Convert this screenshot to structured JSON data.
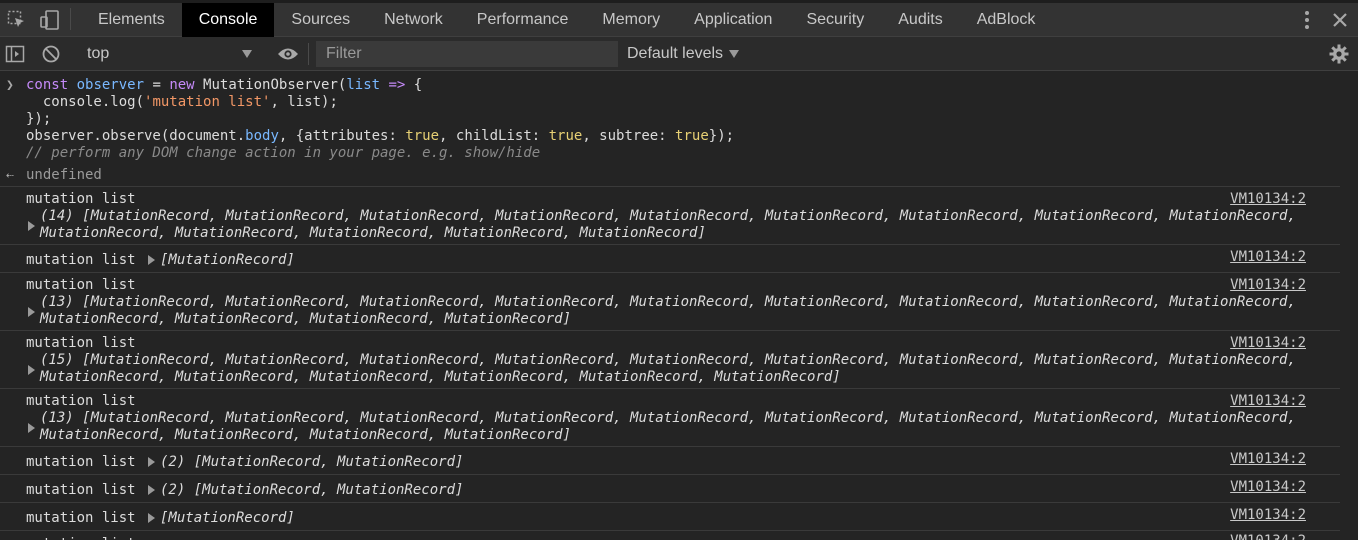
{
  "tabs": [
    {
      "label": "Elements",
      "active": false
    },
    {
      "label": "Console",
      "active": true
    },
    {
      "label": "Sources",
      "active": false
    },
    {
      "label": "Network",
      "active": false
    },
    {
      "label": "Performance",
      "active": false
    },
    {
      "label": "Memory",
      "active": false
    },
    {
      "label": "Application",
      "active": false
    },
    {
      "label": "Security",
      "active": false
    },
    {
      "label": "Audits",
      "active": false
    },
    {
      "label": "AdBlock",
      "active": false
    }
  ],
  "toolbar": {
    "context": "top",
    "filter_placeholder": "Filter",
    "levels": "Default levels"
  },
  "input": {
    "line1": {
      "kw1": "const",
      "var1": "observer",
      "eq": " = ",
      "kw2": "new",
      "rest1": " MutationObserver(",
      "var2": "list",
      "arrow": " => ",
      "brace": "{"
    },
    "line2": {
      "pre": "  console.log(",
      "str": "'mutation list'",
      "post": ", list);"
    },
    "line3": "});",
    "line4": {
      "a": "observer.observe(document.",
      "b": "body",
      "c": ", {attributes: ",
      "t1": "true",
      "d": ", childList: ",
      "t2": "true",
      "e": ", subtree: ",
      "t3": "true",
      "f": "});"
    },
    "line5": "// perform any DOM change action in your page. e.g. show/hide"
  },
  "result": "undefined",
  "log_label": "mutation list",
  "source": "VM10134:2",
  "logs": [
    {
      "line1": "(14) [MutationRecord, MutationRecord, MutationRecord, MutationRecord, MutationRecord, MutationRecord, MutationRecord, MutationRecord, MutationRecord,",
      "line2": "MutationRecord, MutationRecord, MutationRecord, MutationRecord, MutationRecord]"
    },
    {
      "inline": "[MutationRecord]"
    },
    {
      "line1": "(13) [MutationRecord, MutationRecord, MutationRecord, MutationRecord, MutationRecord, MutationRecord, MutationRecord, MutationRecord, MutationRecord,",
      "line2": "MutationRecord, MutationRecord, MutationRecord, MutationRecord]"
    },
    {
      "line1": "(15) [MutationRecord, MutationRecord, MutationRecord, MutationRecord, MutationRecord, MutationRecord, MutationRecord, MutationRecord, MutationRecord,",
      "line2": "MutationRecord, MutationRecord, MutationRecord, MutationRecord, MutationRecord, MutationRecord]"
    },
    {
      "line1": "(13) [MutationRecord, MutationRecord, MutationRecord, MutationRecord, MutationRecord, MutationRecord, MutationRecord, MutationRecord, MutationRecord,",
      "line2": "MutationRecord, MutationRecord, MutationRecord, MutationRecord]"
    },
    {
      "inline": "(2) [MutationRecord, MutationRecord]"
    },
    {
      "inline": "(2) [MutationRecord, MutationRecord]"
    },
    {
      "inline": "[MutationRecord]"
    }
  ],
  "icons": {
    "inspect": "inspect-element-icon",
    "device": "device-toolbar-icon",
    "more": "more-vertical-icon",
    "close": "close-icon",
    "sidebar": "sidebar-toggle-icon",
    "clear": "clear-console-icon",
    "eye": "live-expression-eye-icon",
    "settings": "gear-icon"
  }
}
